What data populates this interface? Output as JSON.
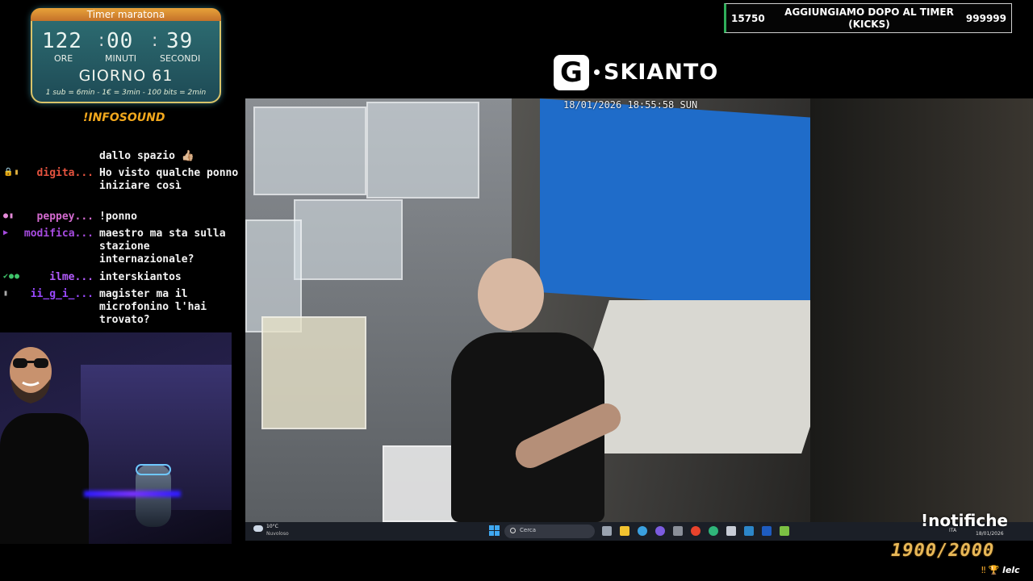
{
  "timer": {
    "title": "Timer maratona",
    "hours": "122",
    "minutes": "00",
    "seconds": "39",
    "hours_label": "ORE",
    "minutes_label": "MINUTI",
    "seconds_label": "SECONDI",
    "day": "GIORNO 61",
    "rates": "1 sub = 6min - 1€ = 3min - 100 bits = 2min"
  },
  "infosound": "!INFOSOUND",
  "chat": [
    {
      "user": "",
      "user_color": "#ffffff",
      "badges": "",
      "text": "dallo spazio 👍🏼"
    },
    {
      "user": "digita...",
      "user_color": "#e5533f",
      "badges": "🔒▮",
      "text": "Ho visto qualche ponno iniziare così"
    },
    {
      "user": "peppey...",
      "user_color": "#d46bd0",
      "badges": "●▮",
      "text": "!ponno"
    },
    {
      "user": "modifica...",
      "user_color": "#a64be0",
      "badges": "▶",
      "text": "maestro ma sta sulla stazione internazionale?"
    },
    {
      "user": "ilme...",
      "user_color": "#b45cff",
      "badges": "✔●●",
      "text": "interskiantos"
    },
    {
      "user": "ii_g_i_...",
      "user_color": "#9a49ff",
      "badges": "▮",
      "text": "magister ma il microfonino l'hai trovato?"
    }
  ],
  "logo": {
    "letter": "G",
    "text": "SKIANTO"
  },
  "camera": {
    "timestamp": "18/01/2026 18:55:58 SUN"
  },
  "taskbar": {
    "weather_temp": "10°C",
    "weather_cond": "Nuvoloso",
    "search_placeholder": "Cerca",
    "language": "ITA",
    "date": "18/01/2026"
  },
  "goal": {
    "min": "15750",
    "label": "AGGIUNGIAMO DOPO AL TIMER (KICKS)",
    "max": "999999"
  },
  "notifiche": "!notifiche",
  "sub_count": "1900/2000",
  "ticker": {
    "user": "lelc"
  },
  "colors": {
    "accent": "#e8b857",
    "goal_bar": "#2fae5a",
    "timer_bg": "#2e6f74"
  }
}
